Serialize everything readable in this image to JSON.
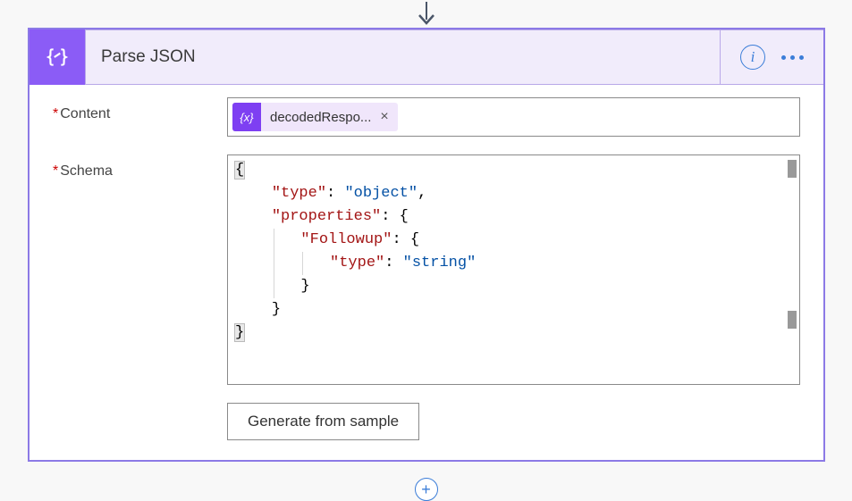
{
  "header": {
    "title": "Parse JSON"
  },
  "fields": {
    "content": {
      "label": "Content",
      "token": {
        "icon_text": "{x}",
        "label": "decodedRespo...",
        "close": "×"
      }
    },
    "schema": {
      "label": "Schema",
      "code": {
        "l1": "{",
        "l2_key": "\"type\"",
        "l2_val": "\"object\"",
        "l3_key": "\"properties\"",
        "l4_key": "\"Followup\"",
        "l5_key": "\"type\"",
        "l5_val": "\"string\"",
        "l6": "}",
        "l7": "}",
        "l8": "}"
      }
    }
  },
  "buttons": {
    "generate": "Generate from sample"
  },
  "icons": {
    "info": "i",
    "plus": "+"
  }
}
